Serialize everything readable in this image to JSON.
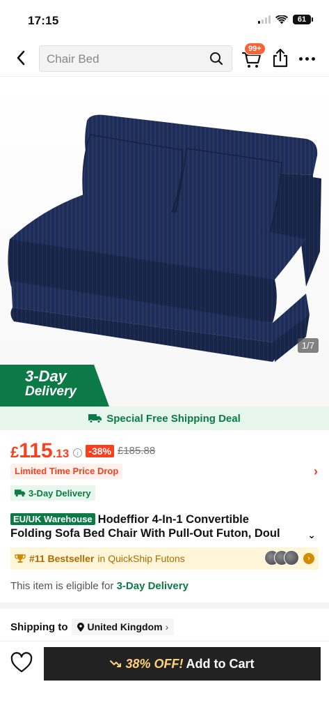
{
  "status_bar": {
    "time": "17:15",
    "battery": "61"
  },
  "header": {
    "search_placeholder": "Chair Bed",
    "cart_badge": "99+"
  },
  "gallery": {
    "counter": "1/7",
    "ribbon_line1": "3-Day",
    "ribbon_line2": "Delivery",
    "product_color": "#1f2d55"
  },
  "shipping_banner": {
    "text": "Special Free Shipping Deal"
  },
  "price": {
    "currency": "£",
    "main": "115",
    "decimal": ".13",
    "discount": "-38%",
    "original": "£185.88"
  },
  "price_drop": {
    "label": "Limited Time Price Drop"
  },
  "delivery_tag": {
    "label": "3-Day Delivery"
  },
  "product": {
    "warehouse_badge": "EU/UK Warehouse",
    "title_line1": "Hodeffior 4-In-1 Convertible",
    "title_line2": "Folding Sofa Bed Chair With Pull-Out Futon, Doul"
  },
  "bestseller": {
    "rank": "#11 Bestseller",
    "category": "in QuickShip Futons"
  },
  "eligibility": {
    "prefix": "This item is eligible for ",
    "highlight": "3-Day Delivery"
  },
  "shipping_to": {
    "label": "Shipping to",
    "country": "United Kingdom"
  },
  "bottom_bar": {
    "discount": "38% OFF!",
    "add_to_cart": "Add to Cart"
  },
  "colors": {
    "accent_red": "#fa3f1e",
    "accent_green": "#0b7a46",
    "cart_button": "#222222"
  }
}
